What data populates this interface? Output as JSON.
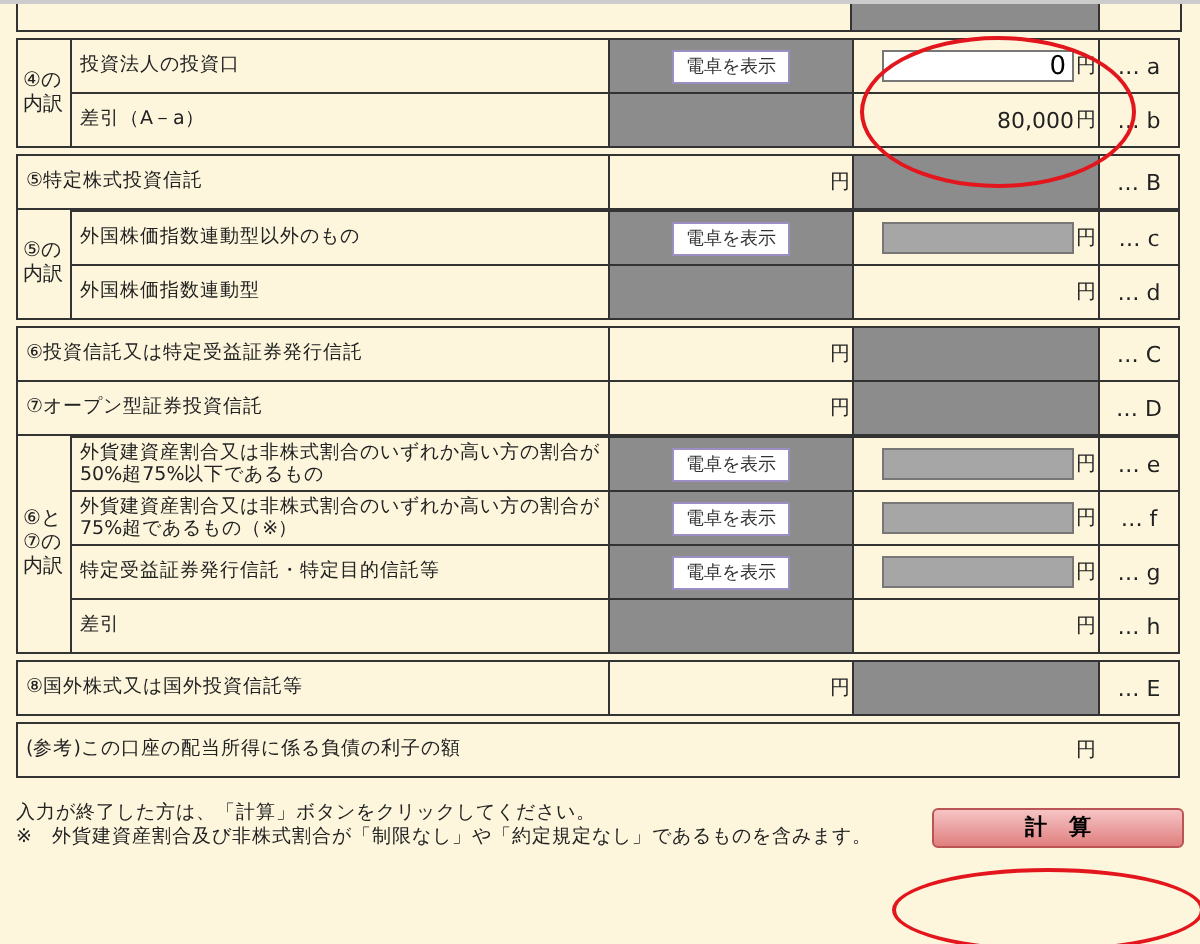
{
  "groups": [
    {
      "group_label": "④の内訳",
      "rows": [
        {
          "label": "投資法人の投資口",
          "col2": {
            "kind": "button",
            "label": "電卓を表示"
          },
          "col3": {
            "kind": "input",
            "value": "0",
            "unit": "円"
          },
          "marker": "… a"
        },
        {
          "label": "差引（A－a）",
          "col2": {
            "kind": "shaded"
          },
          "col3": {
            "kind": "text",
            "value": "80,000",
            "unit": "円"
          },
          "marker": "… b"
        }
      ]
    },
    {
      "rows": [
        {
          "label": "⑤特定株式投資信託",
          "col2": {
            "kind": "text",
            "unit": "円"
          },
          "col3": {
            "kind": "shaded"
          },
          "marker": "… B"
        }
      ]
    },
    {
      "group_label": "⑤の内訳",
      "attached": true,
      "rows": [
        {
          "label": "外国株価指数連動型以外のもの",
          "col2": {
            "kind": "button",
            "label": "電卓を表示"
          },
          "col3": {
            "kind": "input-disabled",
            "unit": "円"
          },
          "marker": "… c"
        },
        {
          "label": "外国株価指数連動型",
          "col2": {
            "kind": "shaded"
          },
          "col3": {
            "kind": "text",
            "unit": "円"
          },
          "marker": "… d"
        }
      ]
    },
    {
      "rows": [
        {
          "label": "⑥投資信託又は特定受益証券発行信託",
          "col2": {
            "kind": "text",
            "unit": "円"
          },
          "col3": {
            "kind": "shaded"
          },
          "marker": "… C"
        },
        {
          "label": "⑦オープン型証券投資信託",
          "col2": {
            "kind": "text",
            "unit": "円"
          },
          "col3": {
            "kind": "shaded"
          },
          "marker": "… D"
        }
      ]
    },
    {
      "group_label": "⑥と⑦の内訳",
      "attached": true,
      "rows": [
        {
          "label": "外貨建資産割合又は非株式割合のいずれか高い方の割合が50%超75%以下であるもの",
          "col2": {
            "kind": "button",
            "label": "電卓を表示"
          },
          "col3": {
            "kind": "input-disabled",
            "unit": "円"
          },
          "marker": "… e"
        },
        {
          "label": "外貨建資産割合又は非株式割合のいずれか高い方の割合が75%超であるもの（※）",
          "col2": {
            "kind": "button",
            "label": "電卓を表示"
          },
          "col3": {
            "kind": "input-disabled",
            "unit": "円"
          },
          "marker": "… f"
        },
        {
          "label": "特定受益証券発行信託・特定目的信託等",
          "col2": {
            "kind": "button",
            "label": "電卓を表示"
          },
          "col3": {
            "kind": "input-disabled",
            "unit": "円"
          },
          "marker": "… g"
        },
        {
          "label": "差引",
          "col2": {
            "kind": "shaded"
          },
          "col3": {
            "kind": "text",
            "unit": "円"
          },
          "marker": "… h"
        }
      ]
    },
    {
      "rows": [
        {
          "label": "⑧国外株式又は国外投資信託等",
          "col2": {
            "kind": "text",
            "unit": "円"
          },
          "col3": {
            "kind": "shaded"
          },
          "marker": "… E"
        }
      ]
    },
    {
      "plain": true,
      "rows": [
        {
          "label": "(参考)この口座の配当所得に係る負債の利子の額",
          "col2": {
            "kind": "none"
          },
          "col3": {
            "kind": "text",
            "unit": "円"
          }
        }
      ]
    }
  ],
  "footer": {
    "lines": [
      "入力が終了した方は、「計算」ボタンをクリックしてください。",
      "※　外貨建資産割合及び非株式割合が「制限なし」や「約定規定なし」であるものを含みます。"
    ],
    "button": "計　算"
  }
}
